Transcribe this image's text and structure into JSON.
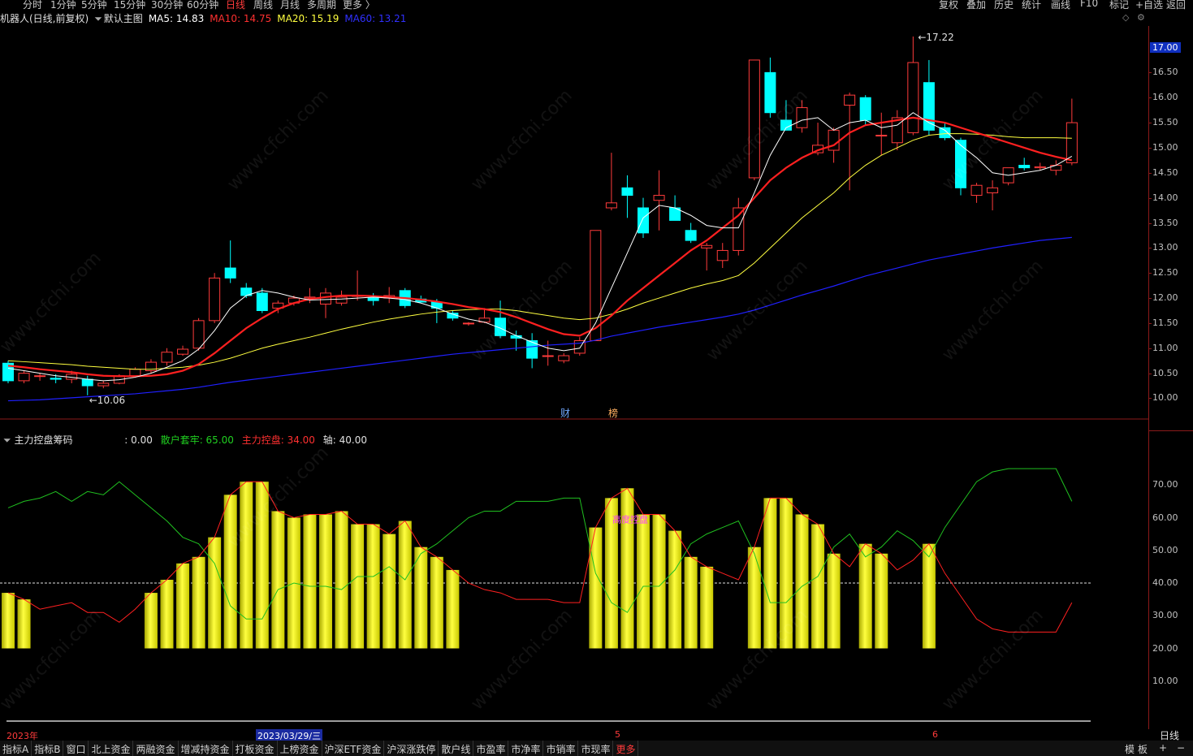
{
  "toolbar": {
    "period_tabs": [
      "分时",
      "1分钟",
      "5分钟",
      "15分钟",
      "30分钟",
      "60分钟",
      "日线",
      "周线",
      "月线",
      "多周期",
      "更多 〉"
    ],
    "active_period": "日线",
    "right_tools": [
      "复权",
      "叠加",
      "历史",
      "统计",
      "画线",
      "F10",
      "标记",
      "+自选",
      "返回"
    ]
  },
  "header": {
    "stock": "机器人(日线,前复权)",
    "template": "默认主图",
    "ma5": "MA5: 14.83",
    "ma10": "MA10: 14.75",
    "ma20": "MA20: 15.19",
    "ma60": "MA60: 13.21"
  },
  "indicator_header": {
    "name": "主力控盘筹码",
    "value0": ": 0.00",
    "retail": "散户套牢: 65.00",
    "main": "主力控盘: 34.00",
    "axis": "轴: 40.00"
  },
  "annotations": {
    "high": "17.22",
    "low": "10.06",
    "high_control": "高度控盘",
    "event_cai": "财",
    "event_bang": "榜",
    "current_price": "17.00"
  },
  "dates": {
    "year": "2023年",
    "selected": "2023/03/29/三",
    "m5": "5",
    "m6": "6",
    "period_label": "日线"
  },
  "bottom_tabs": [
    "指标A",
    "指标B",
    "窗口",
    "北上资金",
    "两融资金",
    "增减持资金",
    "打板资金",
    "上榜资金",
    "沪深ETF资金",
    "沪深涨跌停",
    "散户线",
    "市盈率",
    "市净率",
    "市销率",
    "市现率",
    "更多"
  ],
  "bottom_right": [
    "模",
    "板",
    "+",
    "−"
  ],
  "colors": {
    "up": "#ff3b3b",
    "down": "#00ffff",
    "ma5": "#ffffff",
    "ma10": "#ff2020",
    "ma20": "#ffff40",
    "ma60": "#2020ff",
    "bar": "#ffff00"
  },
  "chart_data": [
    {
      "type": "candlestick",
      "title": "机器人(日线,前复权)",
      "ylim": [
        9.7,
        17.3
      ],
      "y_ticks": [
        10.0,
        10.5,
        11.0,
        11.5,
        12.0,
        12.5,
        13.0,
        13.5,
        14.0,
        14.5,
        15.0,
        15.5,
        16.0,
        16.5
      ],
      "ohlc": [
        [
          10.7,
          10.75,
          10.3,
          10.35
        ],
        [
          10.35,
          10.55,
          10.3,
          10.5
        ],
        [
          10.45,
          10.5,
          10.35,
          10.45
        ],
        [
          10.4,
          10.48,
          10.3,
          10.38
        ],
        [
          10.38,
          10.55,
          10.3,
          10.48
        ],
        [
          10.38,
          10.45,
          10.06,
          10.25
        ],
        [
          10.25,
          10.35,
          10.2,
          10.3
        ],
        [
          10.3,
          10.48,
          10.28,
          10.45
        ],
        [
          10.45,
          10.62,
          10.42,
          10.58
        ],
        [
          10.55,
          10.78,
          10.5,
          10.72
        ],
        [
          10.72,
          11.0,
          10.65,
          10.92
        ],
        [
          10.88,
          11.05,
          10.85,
          10.98
        ],
        [
          11.0,
          11.6,
          10.95,
          11.55
        ],
        [
          11.55,
          12.5,
          11.5,
          12.4
        ],
        [
          12.6,
          13.15,
          12.3,
          12.4
        ],
        [
          12.2,
          12.3,
          12.0,
          12.05
        ],
        [
          12.1,
          12.2,
          11.7,
          11.75
        ],
        [
          11.8,
          11.95,
          11.7,
          11.9
        ],
        [
          11.9,
          12.05,
          11.85,
          12.0
        ],
        [
          12.0,
          12.2,
          11.9,
          12.02
        ],
        [
          11.88,
          12.2,
          11.6,
          12.1
        ],
        [
          11.9,
          12.15,
          11.85,
          12.02
        ],
        [
          12.05,
          12.55,
          11.95,
          12.05
        ],
        [
          12.0,
          12.1,
          11.85,
          11.95
        ],
        [
          12.0,
          12.22,
          11.9,
          12.05
        ],
        [
          12.15,
          12.2,
          11.8,
          11.85
        ],
        [
          11.98,
          12.05,
          11.95,
          11.92
        ],
        [
          11.92,
          11.98,
          11.5,
          11.8
        ],
        [
          11.7,
          11.75,
          11.55,
          11.6
        ],
        [
          11.5,
          11.52,
          11.45,
          11.5
        ],
        [
          11.52,
          11.8,
          11.5,
          11.6
        ],
        [
          11.6,
          11.95,
          11.2,
          11.25
        ],
        [
          11.25,
          11.35,
          10.95,
          11.2
        ],
        [
          11.15,
          11.3,
          10.6,
          10.8
        ],
        [
          10.85,
          11.15,
          10.65,
          10.85
        ],
        [
          10.75,
          10.9,
          10.7,
          10.85
        ],
        [
          10.9,
          11.22,
          10.85,
          11.15
        ],
        [
          11.15,
          13.35,
          11.15,
          13.35
        ],
        [
          13.8,
          14.9,
          13.75,
          13.9
        ],
        [
          14.2,
          14.45,
          13.6,
          14.05
        ],
        [
          13.8,
          14.0,
          13.2,
          13.3
        ],
        [
          13.95,
          14.55,
          13.35,
          14.05
        ],
        [
          13.8,
          14.05,
          13.55,
          13.55
        ],
        [
          13.35,
          13.5,
          13.1,
          13.15
        ],
        [
          13.0,
          13.1,
          12.55,
          13.05
        ],
        [
          12.75,
          13.1,
          12.6,
          12.95
        ],
        [
          12.95,
          14.0,
          12.85,
          13.8
        ],
        [
          14.4,
          16.75,
          14.35,
          16.75
        ],
        [
          16.5,
          16.8,
          15.6,
          15.7
        ],
        [
          15.55,
          15.95,
          15.35,
          15.35
        ],
        [
          15.4,
          15.95,
          15.3,
          15.8
        ],
        [
          14.9,
          15.5,
          14.85,
          15.05
        ],
        [
          14.95,
          15.4,
          14.7,
          15.35
        ],
        [
          15.85,
          16.1,
          14.15,
          16.05
        ],
        [
          16.0,
          16.05,
          15.45,
          15.55
        ],
        [
          15.25,
          15.7,
          14.85,
          15.25
        ],
        [
          15.1,
          15.75,
          14.95,
          15.6
        ],
        [
          15.3,
          17.22,
          15.25,
          16.7
        ],
        [
          16.3,
          16.75,
          15.25,
          15.35
        ],
        [
          15.4,
          15.5,
          15.15,
          15.2
        ],
        [
          15.15,
          15.2,
          14.05,
          14.2
        ],
        [
          14.05,
          14.3,
          13.9,
          14.25
        ],
        [
          14.1,
          14.35,
          13.75,
          14.2
        ],
        [
          14.3,
          14.6,
          14.25,
          14.6
        ],
        [
          14.65,
          14.8,
          14.55,
          14.6
        ],
        [
          14.6,
          14.7,
          14.55,
          14.62
        ],
        [
          14.55,
          14.75,
          14.45,
          14.65
        ],
        [
          14.7,
          15.98,
          14.65,
          15.5
        ]
      ],
      "ma5": [
        10.6,
        10.55,
        10.5,
        10.45,
        10.42,
        10.38,
        10.35,
        10.37,
        10.42,
        10.5,
        10.62,
        10.75,
        10.98,
        11.35,
        11.8,
        12.05,
        12.15,
        12.1,
        12.02,
        11.96,
        11.97,
        11.98,
        12.0,
        12.02,
        12.0,
        11.97,
        11.9,
        11.8,
        11.68,
        11.58,
        11.52,
        11.4,
        11.25,
        11.12,
        11.0,
        10.95,
        11.0,
        11.5,
        12.2,
        12.9,
        13.6,
        13.85,
        13.8,
        13.65,
        13.45,
        13.4,
        13.4,
        14.1,
        14.85,
        15.4,
        15.55,
        15.6,
        15.35,
        15.5,
        15.55,
        15.4,
        15.45,
        15.7,
        15.5,
        15.35,
        15.05,
        14.8,
        14.5,
        14.45,
        14.5,
        14.55,
        14.65,
        14.83
      ],
      "ma10": [
        10.65,
        10.62,
        10.58,
        10.55,
        10.52,
        10.48,
        10.45,
        10.44,
        10.44,
        10.45,
        10.48,
        10.55,
        10.68,
        10.9,
        11.15,
        11.4,
        11.6,
        11.78,
        11.9,
        11.98,
        12.02,
        12.05,
        12.05,
        12.04,
        12.02,
        12.0,
        11.97,
        11.93,
        11.88,
        11.82,
        11.78,
        11.72,
        11.62,
        11.5,
        11.38,
        11.28,
        11.25,
        11.4,
        11.65,
        11.95,
        12.2,
        12.45,
        12.7,
        12.95,
        13.15,
        13.4,
        13.65,
        14.0,
        14.35,
        14.6,
        14.8,
        14.95,
        15.05,
        15.3,
        15.45,
        15.5,
        15.55,
        15.6,
        15.55,
        15.5,
        15.4,
        15.3,
        15.2,
        15.1,
        15.0,
        14.9,
        14.82,
        14.75
      ],
      "ma20": [
        10.75,
        10.73,
        10.71,
        10.69,
        10.67,
        10.64,
        10.62,
        10.6,
        10.58,
        10.58,
        10.6,
        10.62,
        10.66,
        10.72,
        10.8,
        10.9,
        11.0,
        11.08,
        11.15,
        11.22,
        11.3,
        11.38,
        11.45,
        11.52,
        11.58,
        11.63,
        11.68,
        11.72,
        11.75,
        11.77,
        11.78,
        11.78,
        11.75,
        11.7,
        11.65,
        11.6,
        11.57,
        11.6,
        11.68,
        11.78,
        11.9,
        12.0,
        12.1,
        12.2,
        12.28,
        12.35,
        12.45,
        12.7,
        13.0,
        13.3,
        13.6,
        13.85,
        14.1,
        14.4,
        14.65,
        14.85,
        15.0,
        15.15,
        15.25,
        15.28,
        15.28,
        15.27,
        15.25,
        15.22,
        15.2,
        15.2,
        15.2,
        15.19
      ],
      "ma60": [
        9.95,
        9.96,
        9.97,
        9.99,
        10.01,
        10.03,
        10.05,
        10.07,
        10.09,
        10.12,
        10.15,
        10.18,
        10.22,
        10.27,
        10.32,
        10.36,
        10.4,
        10.44,
        10.48,
        10.52,
        10.56,
        10.6,
        10.64,
        10.68,
        10.72,
        10.76,
        10.8,
        10.84,
        10.88,
        10.91,
        10.94,
        10.97,
        11.0,
        11.03,
        11.06,
        11.08,
        11.1,
        11.16,
        11.24,
        11.3,
        11.36,
        11.42,
        11.47,
        11.52,
        11.57,
        11.62,
        11.68,
        11.76,
        11.86,
        11.96,
        12.06,
        12.15,
        12.24,
        12.34,
        12.44,
        12.52,
        12.6,
        12.68,
        12.76,
        12.82,
        12.88,
        12.94,
        13.0,
        13.05,
        13.1,
        13.15,
        13.18,
        13.21
      ]
    },
    {
      "type": "bar",
      "title": "主力控盘筹码",
      "ylim": [
        0,
        80
      ],
      "y_ticks": [
        10,
        20,
        30,
        40,
        50,
        60,
        70
      ],
      "axis_line": 40,
      "bars": [
        37,
        35,
        0,
        0,
        0,
        0,
        0,
        0,
        0,
        37,
        41,
        46,
        48,
        54,
        67,
        71,
        71,
        62,
        60,
        61,
        61,
        62,
        58,
        58,
        55,
        59,
        51,
        48,
        44,
        0,
        0,
        0,
        0,
        0,
        0,
        0,
        0,
        57,
        66,
        69,
        61,
        61,
        56,
        48,
        45,
        0,
        0,
        51,
        66,
        66,
        61,
        58,
        49,
        0,
        52,
        49,
        0,
        0,
        52,
        0,
        0,
        0,
        0,
        0,
        0,
        0,
        0,
        0
      ],
      "main_control": [
        37,
        35,
        32,
        33,
        34,
        31,
        31,
        28,
        32,
        37,
        41,
        46,
        48,
        54,
        67,
        71,
        71,
        62,
        60,
        61,
        61,
        62,
        58,
        58,
        55,
        59,
        51,
        48,
        44,
        40,
        38,
        37,
        35,
        35,
        35,
        34,
        34,
        57,
        66,
        69,
        61,
        61,
        56,
        48,
        45,
        43,
        41,
        51,
        66,
        66,
        61,
        58,
        49,
        45,
        52,
        49,
        44,
        47,
        52,
        43,
        36,
        29,
        26,
        25,
        25,
        25,
        25,
        34
      ],
      "retail_trapped": [
        63,
        65,
        66,
        68,
        65,
        68,
        67,
        71,
        67,
        63,
        59,
        54,
        52,
        46,
        33,
        29,
        29,
        38,
        40,
        39,
        39,
        38,
        42,
        42,
        45,
        41,
        49,
        52,
        56,
        60,
        62,
        62,
        65,
        65,
        65,
        66,
        66,
        43,
        34,
        31,
        39,
        39,
        44,
        52,
        55,
        57,
        59,
        49,
        34,
        34,
        39,
        42,
        51,
        55,
        48,
        51,
        56,
        53,
        48,
        57,
        64,
        71,
        74,
        75,
        75,
        75,
        75,
        65
      ]
    }
  ]
}
